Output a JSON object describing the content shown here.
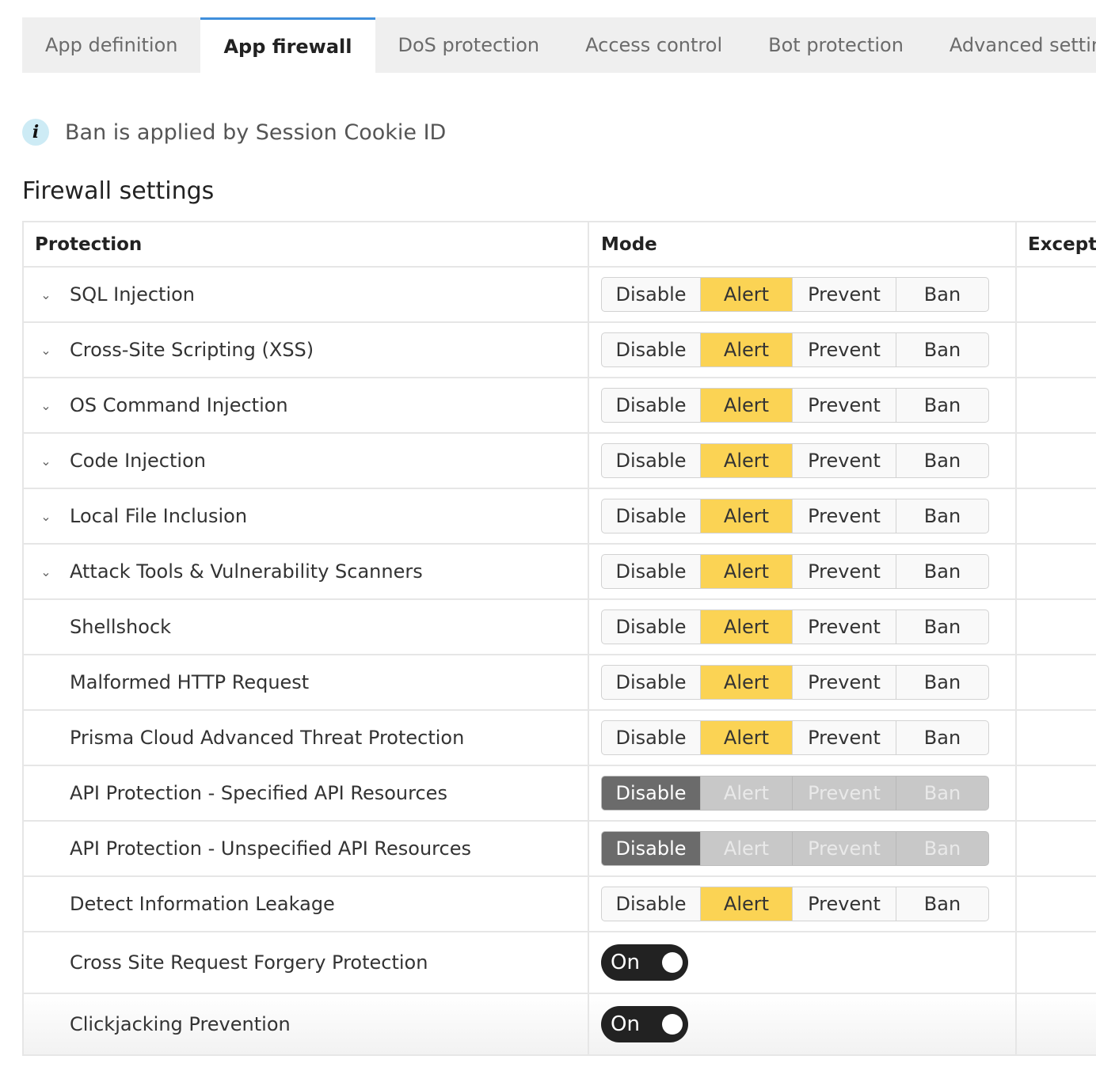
{
  "tabs": [
    {
      "label": "App definition",
      "active": false
    },
    {
      "label": "App firewall",
      "active": true
    },
    {
      "label": "DoS protection",
      "active": false
    },
    {
      "label": "Access control",
      "active": false
    },
    {
      "label": "Bot protection",
      "active": false
    },
    {
      "label": "Advanced settings",
      "active": false
    }
  ],
  "info": {
    "icon": "info-icon",
    "glyph": "i",
    "text": "Ban is applied by Session Cookie ID"
  },
  "section_title": "Firewall settings",
  "table": {
    "headers": {
      "protection": "Protection",
      "mode": "Mode",
      "exceptions": "Excepti"
    },
    "mode_options": [
      "Disable",
      "Alert",
      "Prevent",
      "Ban"
    ],
    "rows": [
      {
        "label": "SQL Injection",
        "expandable": true,
        "type": "mode",
        "selected": "Alert",
        "disabled": false
      },
      {
        "label": "Cross-Site Scripting (XSS)",
        "expandable": true,
        "type": "mode",
        "selected": "Alert",
        "disabled": false
      },
      {
        "label": "OS Command Injection",
        "expandable": true,
        "type": "mode",
        "selected": "Alert",
        "disabled": false
      },
      {
        "label": "Code Injection",
        "expandable": true,
        "type": "mode",
        "selected": "Alert",
        "disabled": false
      },
      {
        "label": "Local File Inclusion",
        "expandable": true,
        "type": "mode",
        "selected": "Alert",
        "disabled": false
      },
      {
        "label": "Attack Tools & Vulnerability Scanners",
        "expandable": true,
        "type": "mode",
        "selected": "Alert",
        "disabled": false
      },
      {
        "label": "Shellshock",
        "expandable": false,
        "type": "mode",
        "selected": "Alert",
        "disabled": false
      },
      {
        "label": "Malformed HTTP Request",
        "expandable": false,
        "type": "mode",
        "selected": "Alert",
        "disabled": false
      },
      {
        "label": "Prisma Cloud Advanced Threat Protection",
        "expandable": false,
        "type": "mode",
        "selected": "Alert",
        "disabled": false
      },
      {
        "label": "API Protection - Specified API Resources",
        "expandable": false,
        "type": "mode",
        "selected": "Disable",
        "disabled": true
      },
      {
        "label": "API Protection - Unspecified API Resources",
        "expandable": false,
        "type": "mode",
        "selected": "Disable",
        "disabled": true
      },
      {
        "label": "Detect Information Leakage",
        "expandable": false,
        "type": "mode",
        "selected": "Alert",
        "disabled": false
      },
      {
        "label": "Cross Site Request Forgery Protection",
        "expandable": false,
        "type": "toggle",
        "toggle_label": "On"
      },
      {
        "label": "Clickjacking Prevention",
        "expandable": false,
        "type": "toggle",
        "toggle_label": "On"
      }
    ]
  },
  "colors": {
    "active_tab_border": "#3f8fdc",
    "alert_selected": "#fbd354",
    "disabled_selected": "#6b6b6b",
    "toggle_on": "#222222"
  },
  "icons": {
    "expand": "chevron-down-icon",
    "info": "info-icon"
  }
}
